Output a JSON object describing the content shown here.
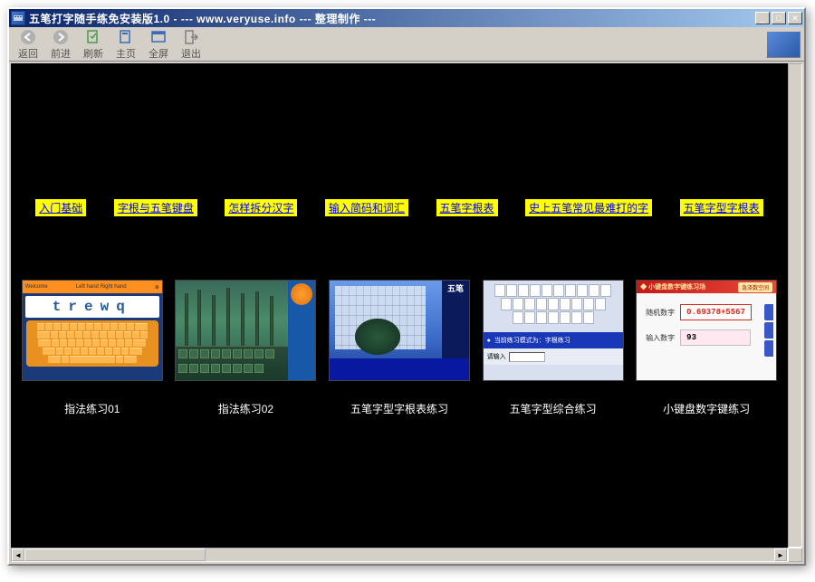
{
  "window": {
    "title": "五笔打字随手练免安装版1.0 - --- www.veryuse.info --- 整理制作 ---"
  },
  "toolbar": {
    "back": "返回",
    "forward": "前进",
    "refresh": "刷新",
    "home": "主页",
    "fullscreen": "全屏",
    "exit": "退出"
  },
  "nav": [
    "入门基础",
    "字根与五笔键盘",
    "怎样拆分汉字",
    "输入简码和词汇",
    "五笔字根表",
    "史上五笔常见最难打的字",
    "五笔字型字根表"
  ],
  "thumbs": [
    {
      "caption": "指法练习01",
      "display": "trewq"
    },
    {
      "caption": "指法练习02"
    },
    {
      "caption": "五笔字型字根表练习",
      "logo": "五笔"
    },
    {
      "caption": "五笔字型综合练习",
      "hint": "当前练习模式为：字根练习",
      "input_label": "请输入"
    },
    {
      "caption": "小键盘数字键练习",
      "header": "小键盘数字键练习场",
      "badge": "急泽数空间",
      "label1": "随机数字",
      "value1": "0.69378+5567",
      "label2": "输入数字",
      "value2": "93"
    }
  ]
}
